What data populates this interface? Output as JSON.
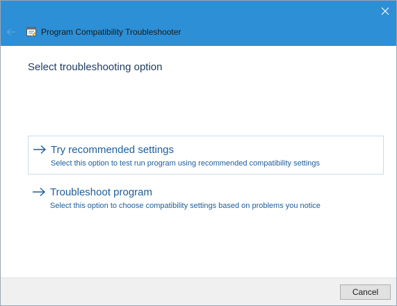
{
  "window": {
    "title": "Program Compatibility Troubleshooter",
    "titlebar_color": "#2d8fd5",
    "close_icon": "close-icon",
    "back_icon": "back-arrow-icon",
    "app_icon": "troubleshooter-app-icon"
  },
  "main": {
    "heading": "Select troubleshooting option",
    "options": [
      {
        "title": "Try recommended settings",
        "description": "Select this option to test run program using recommended compatibility settings",
        "icon": "arrow-right-icon",
        "selected": true
      },
      {
        "title": "Troubleshoot program",
        "description": "Select this option to choose compatibility settings based on problems you notice",
        "icon": "arrow-right-icon",
        "selected": false
      }
    ],
    "link_color": "#1d5d9a"
  },
  "footer": {
    "cancel_label": "Cancel"
  }
}
